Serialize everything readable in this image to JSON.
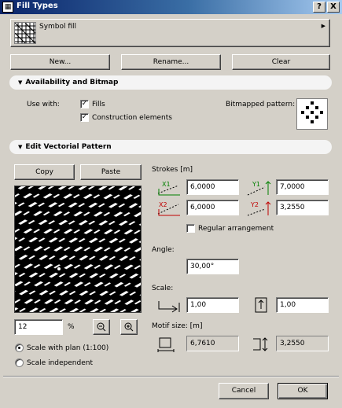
{
  "window": {
    "title": "Fill Types",
    "help_label": "?",
    "close_label": "X"
  },
  "symbol": {
    "name": "Symbol fill"
  },
  "buttons": {
    "new": "New...",
    "rename": "Rename...",
    "clear": "Clear"
  },
  "availability": {
    "header": "Availability and Bitmap",
    "use_with_label": "Use with:",
    "fills_label": "Fills",
    "fills_checked": true,
    "construction_label": "Construction elements",
    "construction_checked": true,
    "bitmapped_label": "Bitmapped pattern:"
  },
  "vectorial": {
    "header": "Edit Vectorial Pattern",
    "copy_label": "Copy",
    "paste_label": "Paste",
    "strokes_label": "Strokes [m]",
    "x1": "6,0000",
    "y1": "7,0000",
    "x2": "6,0000",
    "y2": "3,2550",
    "x1_icon_text": "X1",
    "y1_icon_text": "Y1",
    "x2_icon_text": "X2",
    "y2_icon_text": "Y2",
    "regular_label": "Regular arrangement",
    "regular_checked": false,
    "angle_label": "Angle:",
    "angle_value": "30,00°",
    "scale_label": "Scale:",
    "scale_x": "1,00",
    "scale_y": "1,00",
    "motif_label": "Motif size: [m]",
    "motif_x": "6,7610",
    "motif_y": "3,2550",
    "zoom_value": "12",
    "zoom_unit": "%",
    "scale_with_plan_label": "Scale with plan (1:100)",
    "scale_independent_label": "Scale independent",
    "scale_with_plan_selected": true
  },
  "footer": {
    "cancel_label": "Cancel",
    "ok_label": "OK"
  },
  "colors": {
    "title_dark": "#0a246a",
    "title_light": "#a6caf0",
    "face": "#d4d0c8",
    "green": "#008000",
    "red": "#c00000",
    "blue": "#0000c0"
  }
}
